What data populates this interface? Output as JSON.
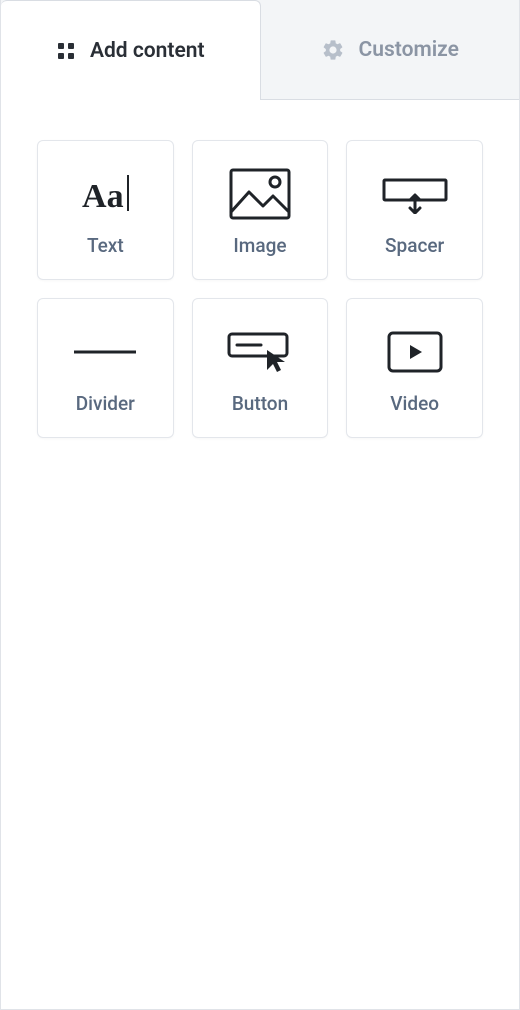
{
  "tabs": {
    "add_content": {
      "label": "Add content",
      "active": true
    },
    "customize": {
      "label": "Customize",
      "active": false
    }
  },
  "tiles": {
    "text": {
      "label": "Text",
      "icon": "text-icon"
    },
    "image": {
      "label": "Image",
      "icon": "image-icon"
    },
    "spacer": {
      "label": "Spacer",
      "icon": "spacer-icon"
    },
    "divider": {
      "label": "Divider",
      "icon": "divider-icon"
    },
    "button": {
      "label": "Button",
      "icon": "button-icon"
    },
    "video": {
      "label": "Video",
      "icon": "video-icon"
    }
  }
}
